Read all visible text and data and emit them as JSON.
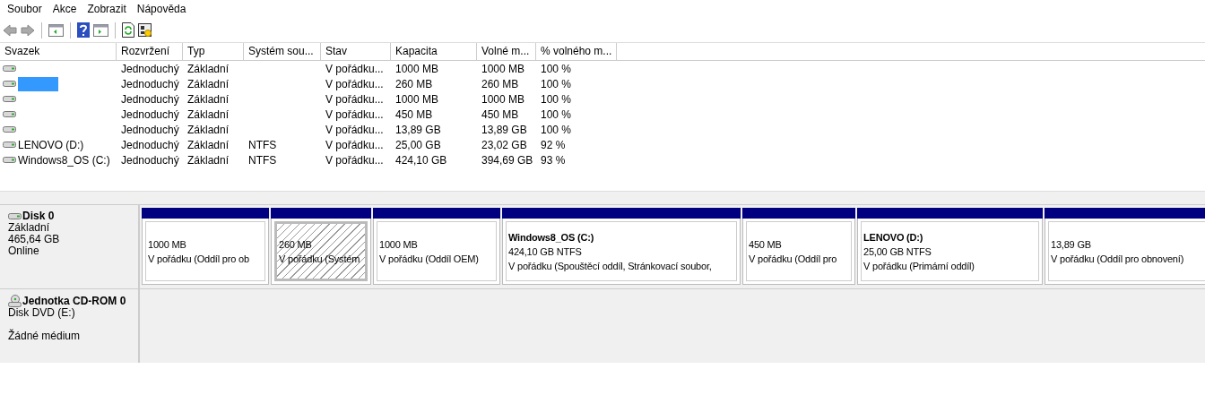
{
  "menu": [
    "Soubor",
    "Akce",
    "Zobrazit",
    "Nápověda"
  ],
  "volumes": {
    "columns": [
      "Svazek",
      "Rozvržení",
      "Typ",
      "Systém sou...",
      "Stav",
      "Kapacita",
      "Volné m...",
      "% volného m..."
    ],
    "rows": [
      {
        "redacted": false,
        "cells": [
          "",
          "Jednoduchý",
          "Základní",
          "",
          "V pořádku...",
          "1000 MB",
          "1000 MB",
          "100 %"
        ]
      },
      {
        "redacted": true,
        "cells": [
          "",
          "Jednoduchý",
          "Základní",
          "",
          "V pořádku...",
          "260 MB",
          "260 MB",
          "100 %"
        ]
      },
      {
        "redacted": false,
        "cells": [
          "",
          "Jednoduchý",
          "Základní",
          "",
          "V pořádku...",
          "1000 MB",
          "1000 MB",
          "100 %"
        ]
      },
      {
        "redacted": false,
        "cells": [
          "",
          "Jednoduchý",
          "Základní",
          "",
          "V pořádku...",
          "450 MB",
          "450 MB",
          "100 %"
        ]
      },
      {
        "redacted": false,
        "cells": [
          "",
          "Jednoduchý",
          "Základní",
          "",
          "V pořádku...",
          "13,89 GB",
          "13,89 GB",
          "100 %"
        ]
      },
      {
        "redacted": false,
        "cells": [
          "LENOVO (D:)",
          "Jednoduchý",
          "Základní",
          "NTFS",
          "V pořádku...",
          "25,00 GB",
          "23,02 GB",
          "92 %"
        ]
      },
      {
        "redacted": false,
        "cells": [
          "Windows8_OS (C:)",
          "Jednoduchý",
          "Základní",
          "NTFS",
          "V pořádku...",
          "424,10 GB",
          "394,69 GB",
          "93 %"
        ]
      }
    ]
  },
  "disks": [
    {
      "kind": "disk",
      "title": "Disk 0",
      "lines": [
        "Základní",
        "465,64 GB",
        "Online"
      ],
      "partitions": [
        {
          "size": "1000 MB",
          "status": "V pořádku (Oddíl pro ob",
          "selected": false
        },
        {
          "size": "260 MB",
          "status": "V pořádku (Systém",
          "selected": true
        },
        {
          "size": "1000 MB",
          "status": "V pořádku (Oddíl OEM)",
          "selected": false
        },
        {
          "name": "Windows8_OS  (C:)",
          "size": "424,10 GB NTFS",
          "status": "V pořádku (Spouštěcí oddíl, Stránkovací soubor,",
          "selected": false
        },
        {
          "size": "450 MB",
          "status": "V pořádku (Oddíl pro",
          "selected": false
        },
        {
          "name": "LENOVO  (D:)",
          "size": "25,00 GB NTFS",
          "status": "V pořádku (Primární oddíl)",
          "selected": false
        },
        {
          "size": "13,89 GB",
          "status": "V pořádku (Oddíl pro obnovení)",
          "selected": false
        }
      ]
    },
    {
      "kind": "cdrom",
      "title": "Jednotka CD-ROM 0",
      "lines": [
        "Disk DVD (E:)",
        "Žádné médium"
      ]
    }
  ]
}
